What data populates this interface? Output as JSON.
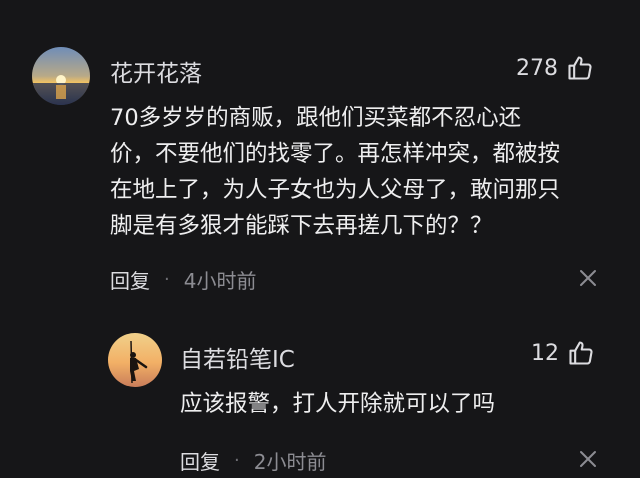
{
  "comments": [
    {
      "username": "花开花落",
      "likes": "278",
      "body_lines": [
        "70多岁岁的商贩，跟他们买菜都不忍心还",
        "价，不要他们的找零了。再怎样冲突，都被按",
        "在地上了，为人子女也为人父母了，敢问那只",
        "脚是有多狠才能踩下去再搓几下的？？"
      ],
      "reply_label": "回复",
      "separator": "·",
      "time": "4小时前",
      "avatar_icon": "sunset-avatar-icon",
      "like_icon": "thumbs-up-icon",
      "dismiss_icon": "close-icon"
    },
    {
      "username": "自若铅笔IC",
      "likes": "12",
      "body_lines": [
        "应该报警，打人开除就可以了吗"
      ],
      "reply_label": "回复",
      "separator": "·",
      "time": "2小时前",
      "avatar_icon": "silhouette-avatar-icon",
      "like_icon": "thumbs-up-icon",
      "dismiss_icon": "close-icon"
    }
  ],
  "colors": {
    "background": "#161618",
    "text_primary": "#eeeeef",
    "text_secondary": "#8c8c92"
  }
}
